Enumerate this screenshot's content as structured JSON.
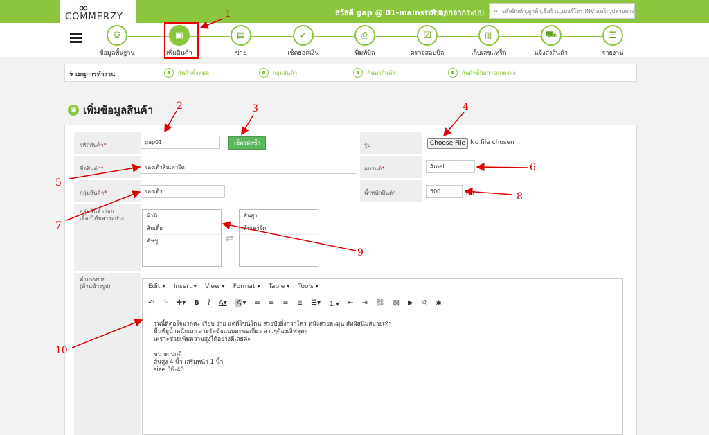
{
  "header": {
    "logo_mark": "∞",
    "logo_text": "COMMERZY",
    "greeting": "สวัสดี gap @ 01-mainstock,",
    "logout_icon": "sign-out-icon",
    "logout": "ออกจากระบบ",
    "search_icon": "search-icon",
    "search_placeholder": "รหัสสินค้า,ลูกค้า,ชื่อร้าน,เบอร์โทร,INV,แทร็ก,ปลายทาง"
  },
  "nav": {
    "items": [
      {
        "label": "ข้อมูลพื้นฐาน",
        "icon": "database-icon"
      },
      {
        "label": "เพิ่มสินค้า",
        "icon": "box-icon"
      },
      {
        "label": "ขาย",
        "icon": "cash-register-icon"
      },
      {
        "label": "เช็คยอดเงิน",
        "icon": "money-check-icon"
      },
      {
        "label": "พิมพ์บิล",
        "icon": "printer-icon"
      },
      {
        "label": "ตรวจสอบบิล",
        "icon": "receipt-check-icon"
      },
      {
        "label": "เก็บเลขแทร็ก",
        "icon": "tracking-icon"
      },
      {
        "label": "แจ้งส่งสินค้า",
        "icon": "truck-icon"
      },
      {
        "label": "รายงาน",
        "icon": "report-icon"
      }
    ]
  },
  "work_menu": {
    "title": "เมนูการทำงาน",
    "items": [
      "สินค้าทั้งหมด",
      "กลุ่มสินค้า",
      "ค้นหาสินค้า",
      "สินค้าที่ปิดการแสดงผล"
    ]
  },
  "page_title": "เพิ่มข้อมูลสินค้า",
  "form": {
    "product_code_label": "รหัสสินค้า",
    "product_code_value": "gap01",
    "check_code_button": "เช็ครหัสซ้ำ",
    "image_label": "รูป",
    "choose_file": "Choose File",
    "no_file": "No file chosen",
    "product_name_label": "ชื่อสินค้า",
    "product_name_value": "รองเท้าส้นเตารีด",
    "brand_label": "แบรนด์",
    "brand_value": "Amel",
    "group_label": "กลุ่มสินค้า",
    "group_value": "รองเท้า",
    "weight_label": "น้ำหนักสินค้า",
    "weight_value": "500",
    "weight_unit": "กรัม",
    "subgroup_label": "กลุ่มสินค้าย่อย",
    "subgroup_hint": "เลือกได้หลายอย่าง",
    "subgroup_available": [
      "ผ้าใบ",
      "ส้นเตี้ย",
      "คัชชู"
    ],
    "subgroup_selected": [
      "ส้นสูง",
      "ส้นเตารีด"
    ],
    "description_label": "คำบรรยาย",
    "description_hint": "(ด้านข้างรูป)"
  },
  "editor": {
    "menus": [
      "Edit ▾",
      "Insert ▾",
      "View ▾",
      "Format ▾",
      "Table ▾",
      "Tools ▾"
    ],
    "content": [
      "รุ่นนี้ดีต่อใจมากค่ะ เรียบ ง่าย แต่ดีไซน์โดน สวยปังยิ่งกว่าใคร หนังสวยละมุน สัมผัสนิ่มสบายเท้า",
      "พื้นพียูน้ำหนักเบา สายรัดข้อแบบตะขอเกี่ยว สาวๆต้องเลิฟสุดๆ",
      "เพราะช่วยเพิ่มความสูงได้อย่างดีเลยค่ะ",
      "",
      "ขนาด ปกติ",
      "ส้นสูง 4 นิ้ว เสริมหน้า 1 นิ้ว",
      "size 36-40"
    ]
  },
  "annotations": [
    "1",
    "2",
    "3",
    "4",
    "5",
    "6",
    "7",
    "8",
    "9",
    "10"
  ],
  "colors": {
    "brand_green": "#8cc63f",
    "annotation_red": "#dd0000",
    "button_green": "#5cb85c"
  }
}
